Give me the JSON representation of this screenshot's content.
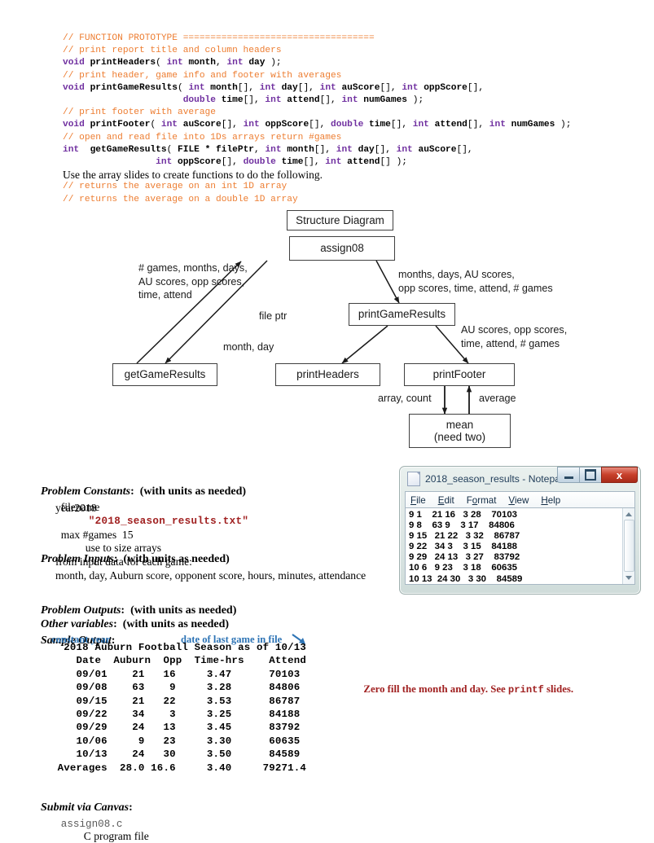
{
  "code": {
    "lines": [
      [
        {
          "t": "// FUNCTION PROTOTYPE ===================================",
          "c": "cmt"
        }
      ],
      [
        {
          "t": "// print report title and column headers",
          "c": "cmt"
        }
      ],
      [
        {
          "t": "void ",
          "c": "kw"
        },
        {
          "t": "printHeaders",
          "c": "id"
        },
        {
          "t": "( ",
          "c": "pl"
        },
        {
          "t": "int ",
          "c": "kw"
        },
        {
          "t": "month",
          "c": "id"
        },
        {
          "t": ", ",
          "c": "pl"
        },
        {
          "t": "int ",
          "c": "kw"
        },
        {
          "t": "day",
          "c": "id"
        },
        {
          "t": " );",
          "c": "pl"
        }
      ],
      [
        {
          "t": "// print header, game info and footer with averages",
          "c": "cmt"
        }
      ],
      [
        {
          "t": "void ",
          "c": "kw"
        },
        {
          "t": "printGameResults",
          "c": "id"
        },
        {
          "t": "( ",
          "c": "pl"
        },
        {
          "t": "int ",
          "c": "kw"
        },
        {
          "t": "month",
          "c": "id"
        },
        {
          "t": "[], ",
          "c": "pl"
        },
        {
          "t": "int ",
          "c": "kw"
        },
        {
          "t": "day",
          "c": "id"
        },
        {
          "t": "[], ",
          "c": "pl"
        },
        {
          "t": "int ",
          "c": "kw"
        },
        {
          "t": "auScore",
          "c": "id"
        },
        {
          "t": "[], ",
          "c": "pl"
        },
        {
          "t": "int ",
          "c": "kw"
        },
        {
          "t": "oppScore",
          "c": "id"
        },
        {
          "t": "[],",
          "c": "pl"
        }
      ],
      [
        {
          "t": "                      ",
          "c": "pl"
        },
        {
          "t": "double ",
          "c": "kw"
        },
        {
          "t": "time",
          "c": "id"
        },
        {
          "t": "[], ",
          "c": "pl"
        },
        {
          "t": "int ",
          "c": "kw"
        },
        {
          "t": "attend",
          "c": "id"
        },
        {
          "t": "[], ",
          "c": "pl"
        },
        {
          "t": "int ",
          "c": "kw"
        },
        {
          "t": "numGames",
          "c": "id"
        },
        {
          "t": " );",
          "c": "pl"
        }
      ],
      [
        {
          "t": "// print footer with average",
          "c": "cmt"
        }
      ],
      [
        {
          "t": "void ",
          "c": "kw"
        },
        {
          "t": "printFooter",
          "c": "id"
        },
        {
          "t": "( ",
          "c": "pl"
        },
        {
          "t": "int ",
          "c": "kw"
        },
        {
          "t": "auScore",
          "c": "id"
        },
        {
          "t": "[], ",
          "c": "pl"
        },
        {
          "t": "int ",
          "c": "kw"
        },
        {
          "t": "oppScore",
          "c": "id"
        },
        {
          "t": "[], ",
          "c": "pl"
        },
        {
          "t": "double ",
          "c": "kw"
        },
        {
          "t": "time",
          "c": "id"
        },
        {
          "t": "[], ",
          "c": "pl"
        },
        {
          "t": "int ",
          "c": "kw"
        },
        {
          "t": "attend",
          "c": "id"
        },
        {
          "t": "[], ",
          "c": "pl"
        },
        {
          "t": "int ",
          "c": "kw"
        },
        {
          "t": "numGames",
          "c": "id"
        },
        {
          "t": " );",
          "c": "pl"
        }
      ],
      [
        {
          "t": "// open and read file into 1Ds arrays return #games",
          "c": "cmt"
        }
      ],
      [
        {
          "t": "int ",
          "c": "kw"
        },
        {
          "t": " ",
          "c": "pl"
        },
        {
          "t": "getGameResults",
          "c": "id"
        },
        {
          "t": "( ",
          "c": "pl"
        },
        {
          "t": "FILE * filePtr",
          "c": "id"
        },
        {
          "t": ", ",
          "c": "pl"
        },
        {
          "t": "int ",
          "c": "kw"
        },
        {
          "t": "month",
          "c": "id"
        },
        {
          "t": "[], ",
          "c": "pl"
        },
        {
          "t": "int ",
          "c": "kw"
        },
        {
          "t": "day",
          "c": "id"
        },
        {
          "t": "[], ",
          "c": "pl"
        },
        {
          "t": "int ",
          "c": "kw"
        },
        {
          "t": "auScore",
          "c": "id"
        },
        {
          "t": "[],",
          "c": "pl"
        }
      ],
      [
        {
          "t": "                 ",
          "c": "pl"
        },
        {
          "t": "int ",
          "c": "kw"
        },
        {
          "t": "oppScore",
          "c": "id"
        },
        {
          "t": "[], ",
          "c": "pl"
        },
        {
          "t": "double ",
          "c": "kw"
        },
        {
          "t": "time",
          "c": "id"
        },
        {
          "t": "[], ",
          "c": "pl"
        },
        {
          "t": "int ",
          "c": "kw"
        },
        {
          "t": "attend",
          "c": "id"
        },
        {
          "t": "[] );",
          "c": "pl"
        }
      ]
    ],
    "prose": "Use the array slides to create functions to do the following.",
    "lines_after": [
      [
        {
          "t": "// returns the average on an int 1D array",
          "c": "cmt"
        }
      ],
      [
        {
          "t": "// returns the average on a double 1D array",
          "c": "cmt"
        }
      ]
    ]
  },
  "diagram": {
    "boxes": {
      "title": "Structure Diagram",
      "assign08": "assign08",
      "get_game_results": "getGameResults",
      "print_game_results": "printGameResults",
      "print_headers": "printHeaders",
      "print_footer": "printFooter",
      "mean_line1": "mean",
      "mean_line2": "(need two)"
    },
    "edge_labels": {
      "get_results_out": "# games, months, days,\nAU scores, opp scores,\ntime, attend",
      "file_ptr": "file ptr",
      "to_print_game_results": "months, days, AU scores,\nopp scores, time, attend, # games",
      "month_day": "month, day",
      "to_print_footer": "AU scores, opp scores,\ntime, attend,  # games",
      "array_count": "array, count",
      "average": "average"
    }
  },
  "problem_constants": {
    "heading_italic": "Problem Constants",
    "heading_rest": ":  (with units as needed)",
    "rows": [
      {
        "label": "filename",
        "value": "\"2018_season_results.txt\"",
        "note": ""
      },
      {
        "label": "year2018",
        "value": "",
        "note": ""
      },
      {
        "label": "max #games  15",
        "value": "",
        "note": "use to size arrays"
      }
    ]
  },
  "problem_inputs": {
    "heading_italic": "Problem Inputs",
    "heading_rest": ":  (with units as needed)",
    "line1": "from input data for each game:",
    "line2": "month, day, Auburn score, opponent score, hours, minutes, attendance"
  },
  "problem_outputs": {
    "heading_italic": "Problem Outputs",
    "heading_rest": ":  (with units as needed)"
  },
  "other_variables": {
    "heading_italic": "Other variables",
    "heading_rest": ":  (with units as needed)"
  },
  "notepad": {
    "title": "2018_season_results - Notepad",
    "menus": [
      "File",
      "Edit",
      "Format",
      "View",
      "Help"
    ],
    "minimize_label": "minimize",
    "maximize_label": "maximize",
    "close_label": "x",
    "content": "9 1    21 16   3 28    70103\n9 8    63 9    3 17    84806\n9 15   21 22   3 32    86787\n9 22   34 3    3 15    84188\n9 29   24 13   3 27    83792\n10 6   9 23    3 18    60635\n10 13  24 30   3 30    84589"
  },
  "sample_output": {
    "heading_italic": "Sample Output",
    "heading_rest": ":",
    "annotation_left": "constant year",
    "annotation_right": "date of last game in file",
    "text": "  2018 Auburn Football Season as of 10/13\n    Date  Auburn  Opp  Time-hrs    Attend\n    09/01    21   16     3.47      70103\n    09/08    63    9     3.28      84806\n    09/15    21   22     3.53      86787\n    09/22    34    3     3.25      84188\n    09/29    24   13     3.45      83792\n    10/06     9   23     3.30      60635\n    10/13    24   30     3.50      84589\n Averages  28.0 16.6     3.40     79271.4",
    "note_before": "Zero fill the month and day. See ",
    "note_mono": "printf",
    "note_after": " slides."
  },
  "submit": {
    "heading_italic": "Submit via Canvas",
    "heading_rest": ":",
    "file_name": "assign08.c",
    "file_desc": "C program file"
  }
}
